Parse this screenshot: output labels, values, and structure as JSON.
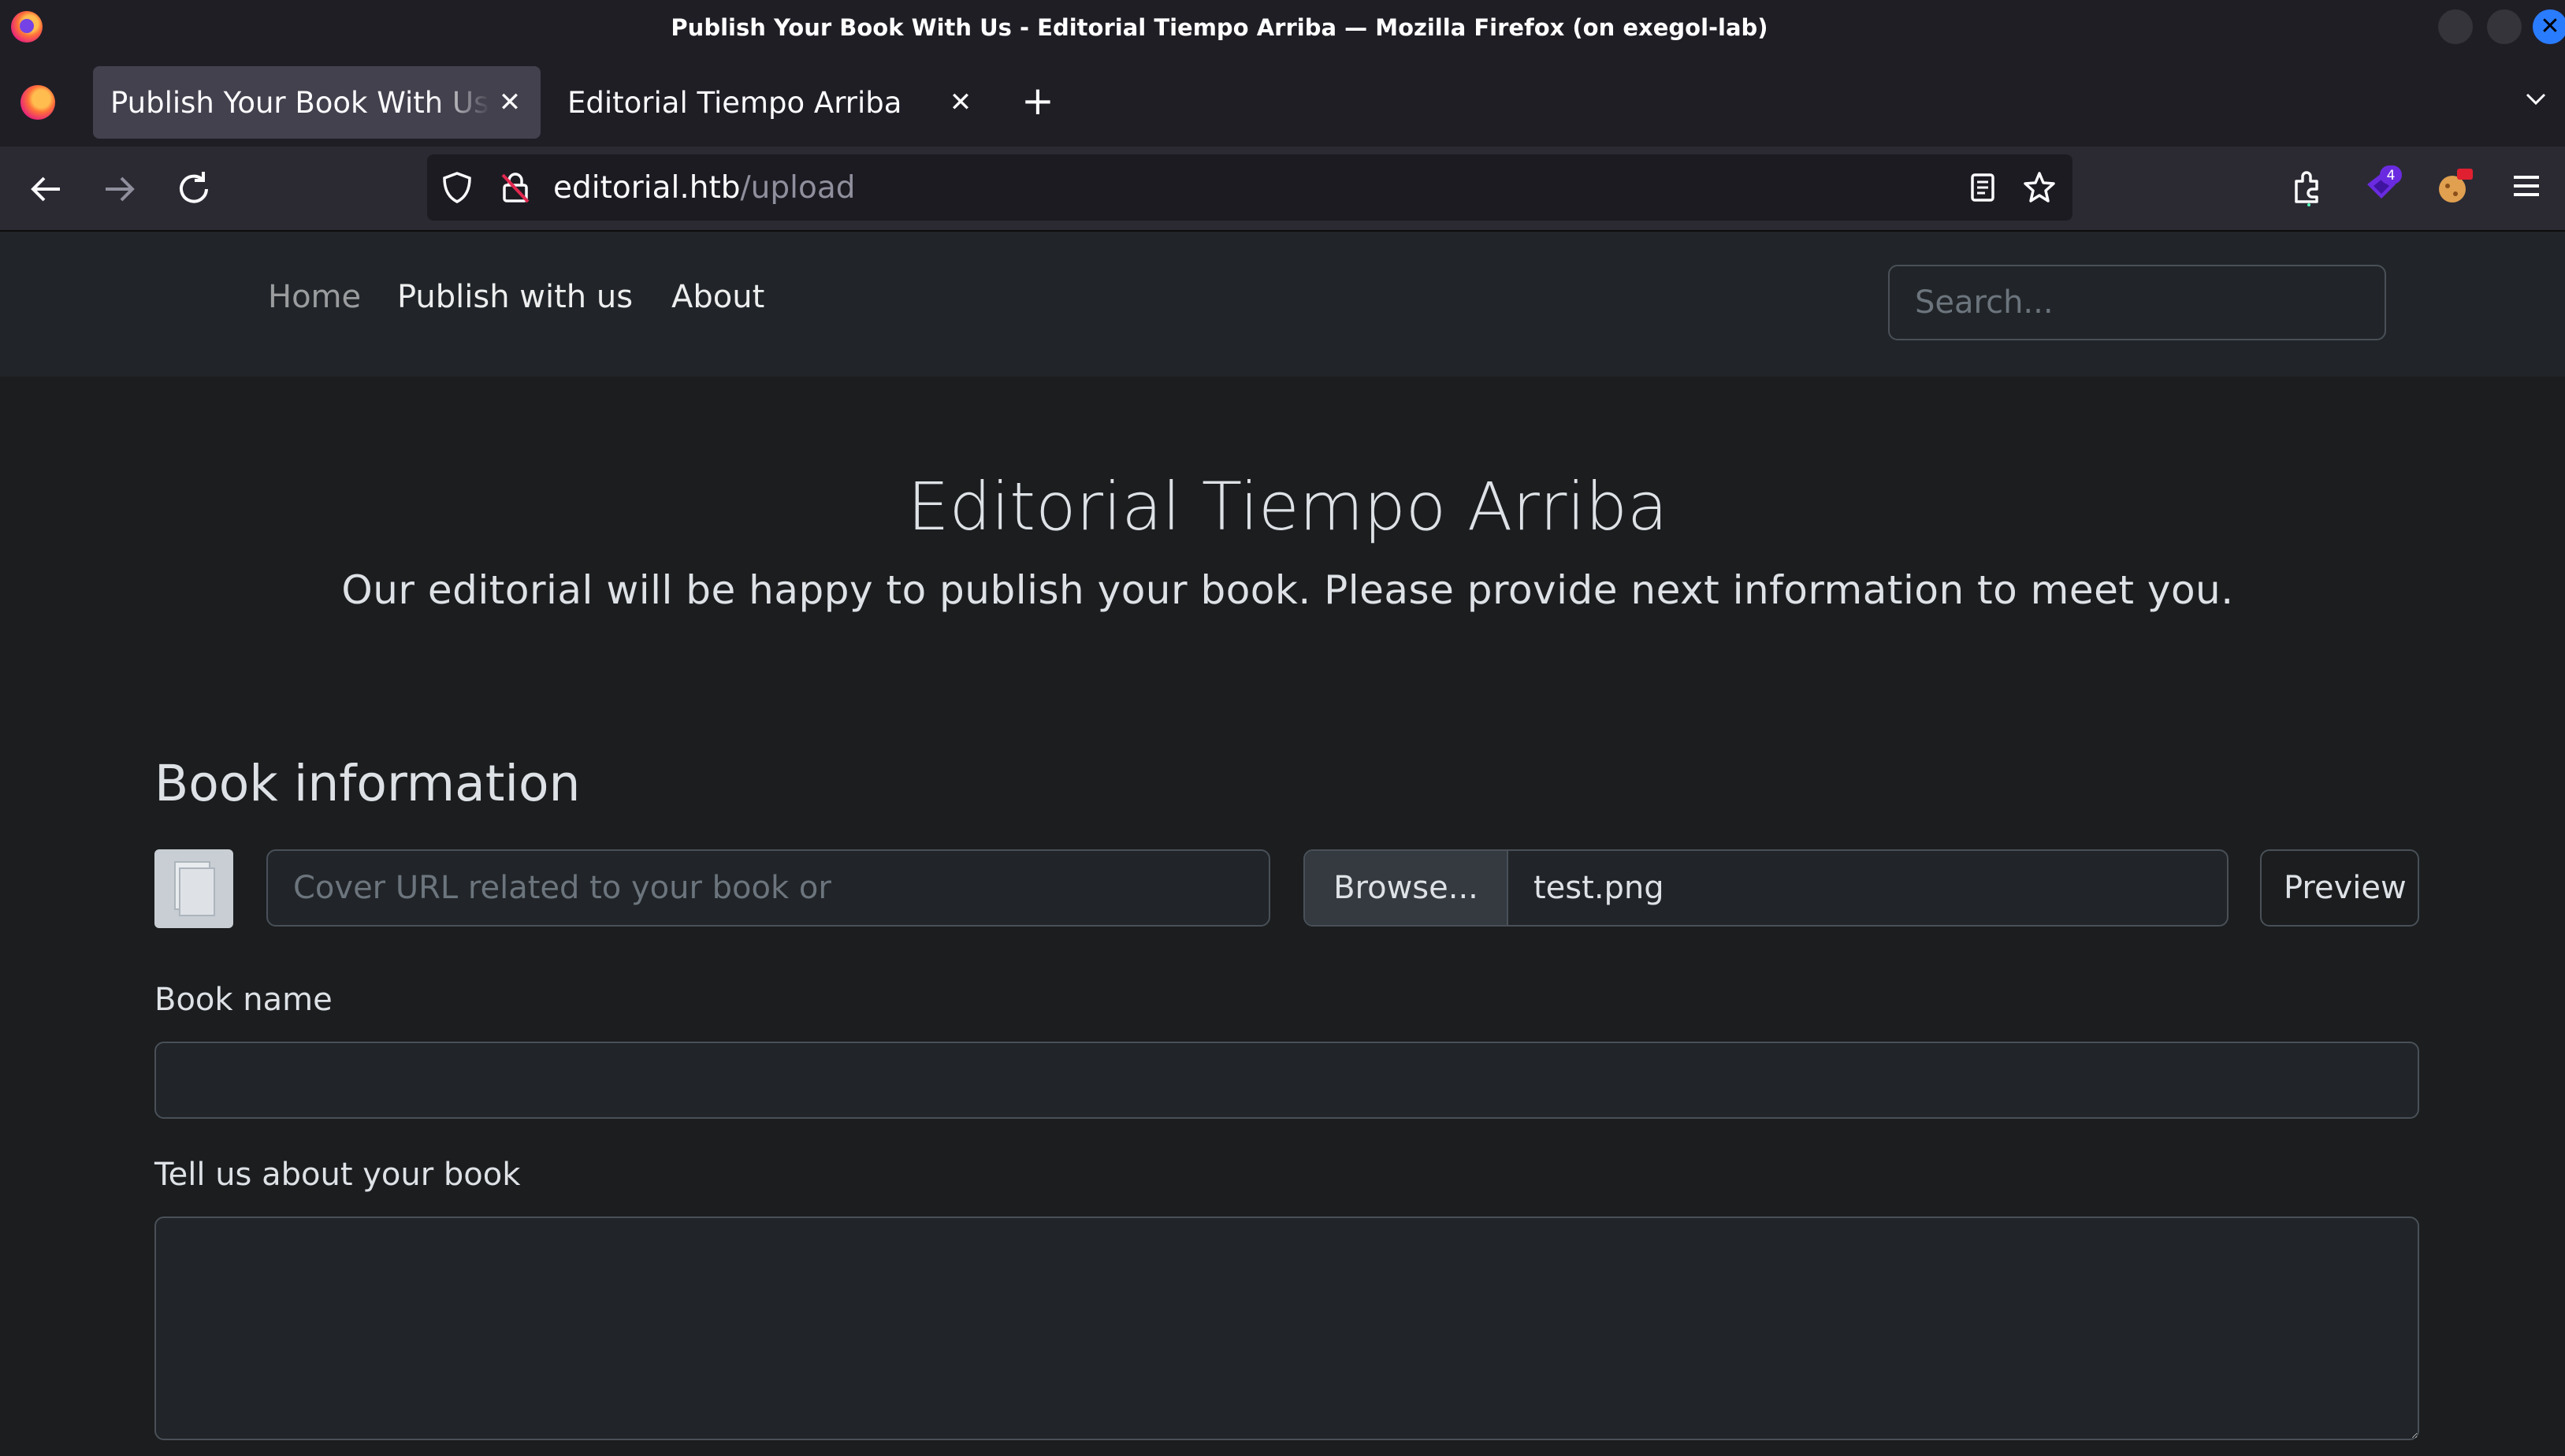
{
  "window": {
    "title": "Publish Your Book With Us - Editorial Tiempo Arriba — Mozilla Firefox (on exegol-lab)"
  },
  "tabs": [
    {
      "label": "Publish Your Book With Us",
      "active": true
    },
    {
      "label": "Editorial Tiempo Arriba",
      "active": false
    }
  ],
  "toolbar": {
    "url_host": "editorial.htb",
    "url_path": "/upload",
    "extension_badge": "4"
  },
  "site": {
    "nav": [
      {
        "label": "Home"
      },
      {
        "label": "Publish with us"
      },
      {
        "label": "About"
      }
    ],
    "search_placeholder": "Search..."
  },
  "main": {
    "title": "Editorial Tiempo Arriba",
    "subtitle": "Our editorial will be happy to publish your book. Please provide next information to meet you."
  },
  "form": {
    "section_title": "Book information",
    "cover_url_placeholder": "Cover URL related to your book or",
    "browse_label": "Browse...",
    "file_name": "test.png",
    "preview_label": "Preview",
    "book_name_label": "Book name",
    "book_name_value": "",
    "about_label": "Tell us about your book",
    "about_value": ""
  }
}
